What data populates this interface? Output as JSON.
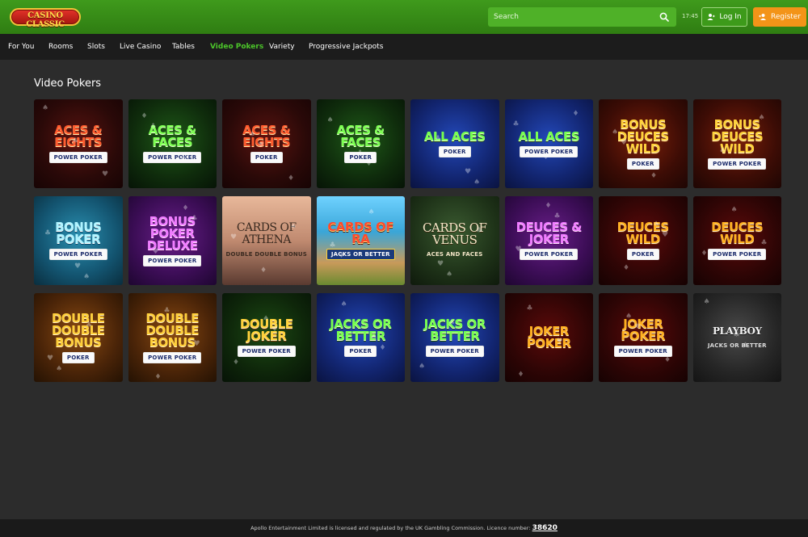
{
  "header": {
    "logo_text": "CASINO CLASSIC",
    "search": {
      "placeholder": "Search",
      "icon": "search-icon"
    },
    "clock": "17:45",
    "login_label": "Log In",
    "register_label": "Register",
    "colors": {
      "topbar": "#3f9a1c",
      "register": "#f39418",
      "active_nav": "#4cc62a"
    }
  },
  "nav": {
    "items": [
      {
        "label": "For You",
        "active": false
      },
      {
        "label": "Rooms",
        "active": false
      },
      {
        "label": "Slots",
        "active": false
      },
      {
        "label": "Live Casino",
        "active": false
      },
      {
        "label": "Tables",
        "active": false
      },
      {
        "label": "Video Pokers",
        "active": true
      },
      {
        "label": "Variety",
        "active": false
      },
      {
        "label": "Progressive Jackpots",
        "active": false
      }
    ]
  },
  "section": {
    "title": "Video Pokers",
    "games": [
      {
        "title": "Aces & Eights",
        "badge": "POWER POKER",
        "theme": "t-red"
      },
      {
        "title": "Aces & Faces",
        "badge": "POWER POKER",
        "theme": "t-green"
      },
      {
        "title": "Aces & Eights",
        "badge": "POKER",
        "theme": "t-red"
      },
      {
        "title": "Aces & Faces",
        "badge": "POKER",
        "theme": "t-green"
      },
      {
        "title": "All Aces",
        "badge": "POKER",
        "theme": "t-blue"
      },
      {
        "title": "All Aces",
        "badge": "POWER POKER",
        "theme": "t-blue"
      },
      {
        "title": "Bonus Deuces Wild",
        "badge": "POKER",
        "theme": "t-gold"
      },
      {
        "title": "Bonus Deuces Wild",
        "badge": "POWER POKER",
        "theme": "t-gold"
      },
      {
        "title": "Bonus Poker",
        "badge": "POWER POKER",
        "theme": "t-cyan"
      },
      {
        "title": "Bonus Poker Deluxe",
        "badge": "POWER POKER",
        "theme": "t-purple"
      },
      {
        "title": "Cards of Athena",
        "badge": "DOUBLE DOUBLE BONUS",
        "theme": "t-athena"
      },
      {
        "title": "Cards of Ra",
        "badge": "JACKS OR BETTER",
        "theme": "t-cards"
      },
      {
        "title": "Cards of Venus",
        "badge": "ACES AND FACES",
        "theme": "t-venus"
      },
      {
        "title": "Deuces & Joker",
        "badge": "POWER POKER",
        "theme": "t-purple"
      },
      {
        "title": "Deuces Wild",
        "badge": "POKER",
        "theme": "t-darkred"
      },
      {
        "title": "Deuces Wild",
        "badge": "POWER POKER",
        "theme": "t-darkred"
      },
      {
        "title": "Double Double Bonus",
        "badge": "POKER",
        "theme": "t-bronze"
      },
      {
        "title": "Double Double Bonus",
        "badge": "POWER POKER",
        "theme": "t-bronze"
      },
      {
        "title": "Double Joker",
        "badge": "POWER POKER",
        "theme": "t-goldgreen"
      },
      {
        "title": "Jacks or Better",
        "badge": "POKER",
        "theme": "t-blue"
      },
      {
        "title": "Jacks or Better",
        "badge": "POWER POKER",
        "theme": "t-blue"
      },
      {
        "title": "Joker Poker",
        "badge": "",
        "theme": "t-darkred"
      },
      {
        "title": "Joker Poker",
        "badge": "POWER POKER",
        "theme": "t-darkred"
      },
      {
        "title": "Playboy",
        "badge": "JACKS OR BETTER",
        "theme": "t-playboy"
      }
    ]
  },
  "footer": {
    "text": "Apollo Entertainment Limited is licensed and regulated by the UK Gambling Commission. Licence number:",
    "licence_number": "38620"
  }
}
